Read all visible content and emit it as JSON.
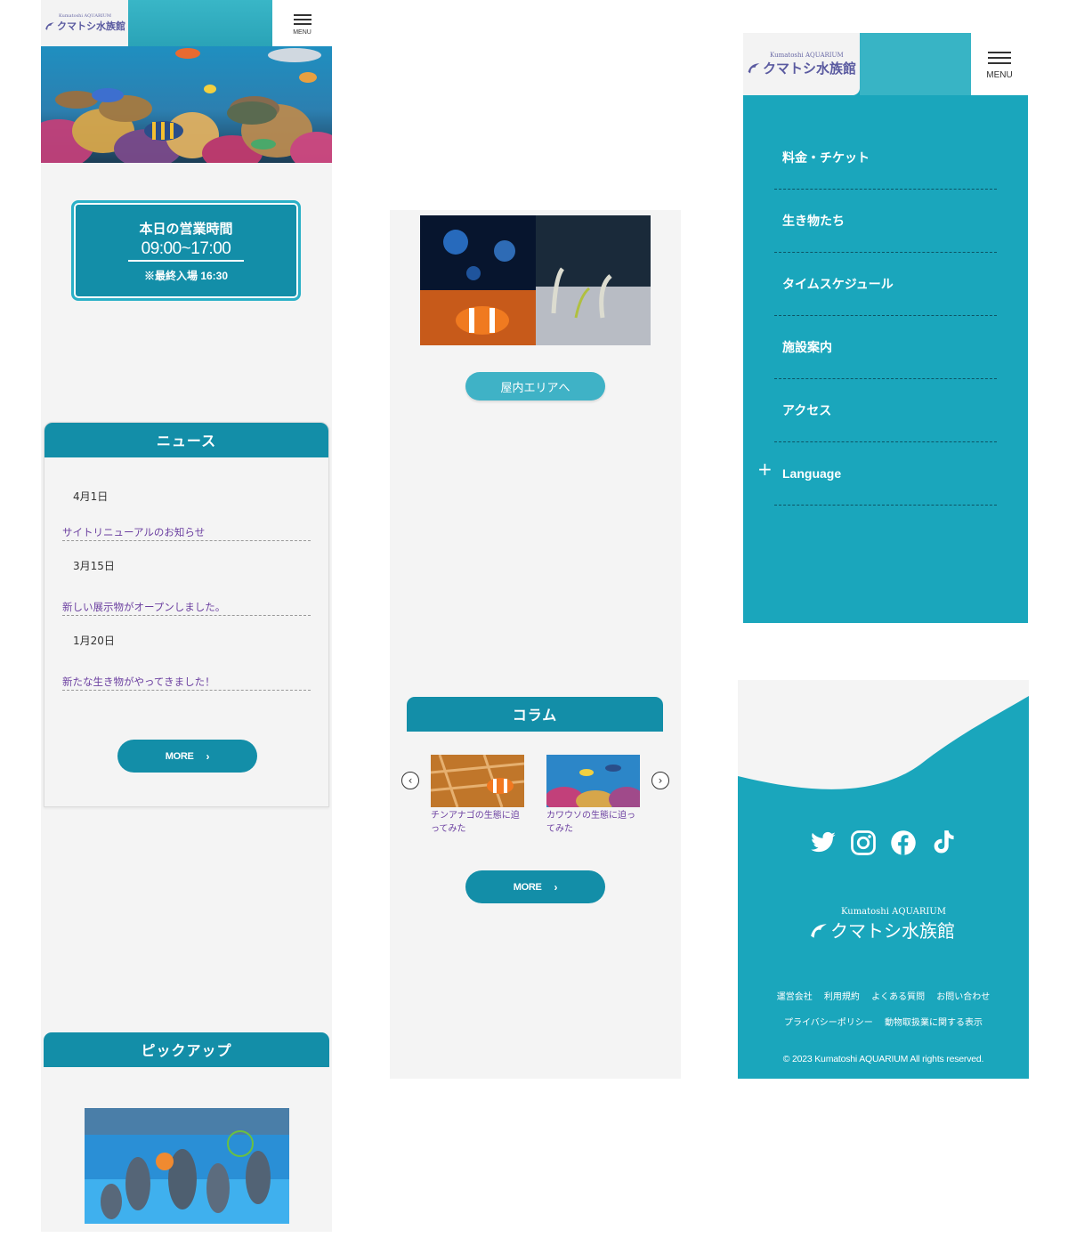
{
  "brand": {
    "name_en": "Kumatoshi AQUARIUM",
    "name_ja": "クマトシ水族館"
  },
  "header": {
    "menu_label": "MENU"
  },
  "hours": {
    "title": "本日の営業時間",
    "time": "09:00~17:00",
    "note": "※最終入場 16:30"
  },
  "news": {
    "heading": "ニュース",
    "items": [
      {
        "date": "4月1日",
        "title": "サイトリニューアルのお知らせ"
      },
      {
        "date": "3月15日",
        "title": "新しい展示物がオープンしました。"
      },
      {
        "date": "1月20日",
        "title": "新たな生き物がやってきました！"
      }
    ],
    "more_label": "MORE",
    "more_chevron": "›"
  },
  "pickup": {
    "heading": "ピックアップ"
  },
  "indoor": {
    "button_label": "屋内エリアへ"
  },
  "column": {
    "heading": "コラム",
    "items": [
      {
        "caption": "チンアナゴの生態に迫ってみた"
      },
      {
        "caption": "カワウソの生態に迫ってみた"
      }
    ],
    "prev_arrow": "‹",
    "next_arrow": "›",
    "more_label": "MORE",
    "more_chevron": "›"
  },
  "menu": {
    "items": [
      "料金・チケット",
      "生き物たち",
      "タイムスケジュール",
      "施設案内",
      "アクセス"
    ],
    "language_label": "Language",
    "language_plus": "+"
  },
  "footer": {
    "social_icons": [
      "twitter-icon",
      "instagram-icon",
      "facebook-icon",
      "tiktok-icon"
    ],
    "links_row1": [
      "運営会社",
      "利用規約",
      "よくある質問",
      "お問い合わせ"
    ],
    "links_row2": [
      "プライバシーポリシー",
      "動物取扱業に関する表示"
    ],
    "copyright": "© 2023 Kumatoshi AQUARIUM All rights reserved."
  },
  "colors": {
    "primary": "#138ea8",
    "menu_bg": "#1aa6bc",
    "footer_bg": "#1aa6bc",
    "link_purple": "#6b3fa0",
    "panel_bg": "#f4f4f4"
  }
}
